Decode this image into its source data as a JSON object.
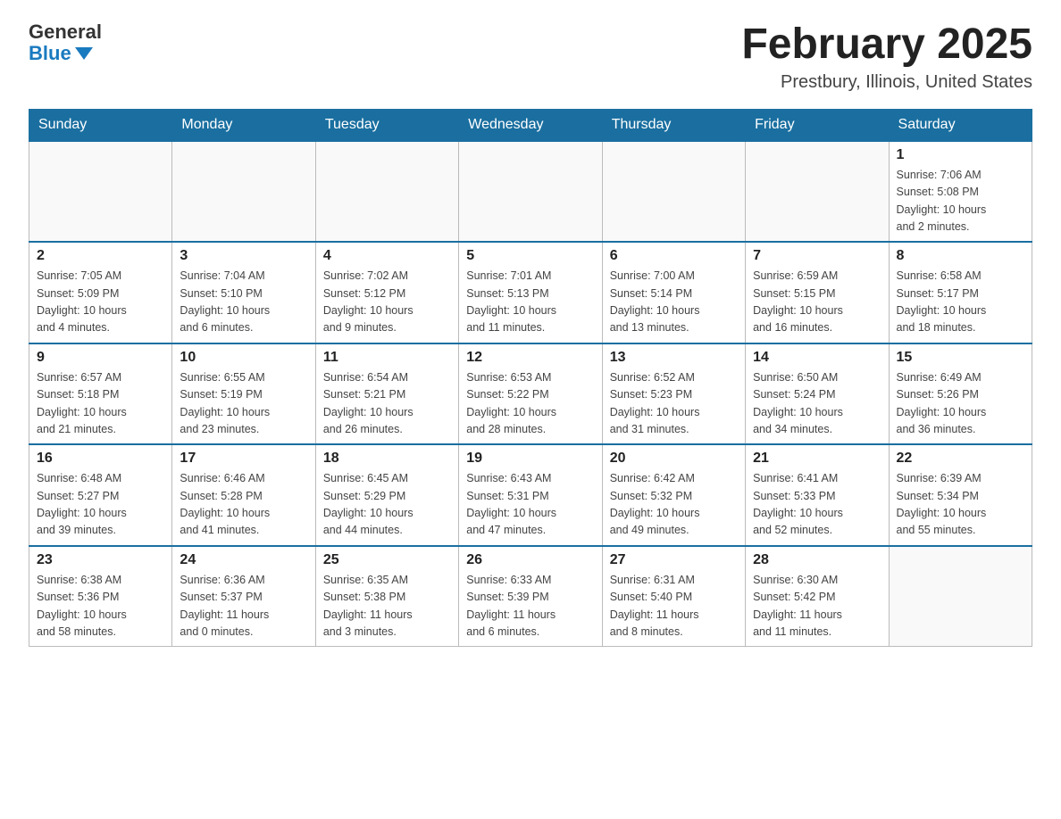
{
  "logo": {
    "general": "General",
    "blue": "Blue"
  },
  "title": "February 2025",
  "subtitle": "Prestbury, Illinois, United States",
  "days_of_week": [
    "Sunday",
    "Monday",
    "Tuesday",
    "Wednesday",
    "Thursday",
    "Friday",
    "Saturday"
  ],
  "weeks": [
    [
      {
        "day": "",
        "info": ""
      },
      {
        "day": "",
        "info": ""
      },
      {
        "day": "",
        "info": ""
      },
      {
        "day": "",
        "info": ""
      },
      {
        "day": "",
        "info": ""
      },
      {
        "day": "",
        "info": ""
      },
      {
        "day": "1",
        "info": "Sunrise: 7:06 AM\nSunset: 5:08 PM\nDaylight: 10 hours\nand 2 minutes."
      }
    ],
    [
      {
        "day": "2",
        "info": "Sunrise: 7:05 AM\nSunset: 5:09 PM\nDaylight: 10 hours\nand 4 minutes."
      },
      {
        "day": "3",
        "info": "Sunrise: 7:04 AM\nSunset: 5:10 PM\nDaylight: 10 hours\nand 6 minutes."
      },
      {
        "day": "4",
        "info": "Sunrise: 7:02 AM\nSunset: 5:12 PM\nDaylight: 10 hours\nand 9 minutes."
      },
      {
        "day": "5",
        "info": "Sunrise: 7:01 AM\nSunset: 5:13 PM\nDaylight: 10 hours\nand 11 minutes."
      },
      {
        "day": "6",
        "info": "Sunrise: 7:00 AM\nSunset: 5:14 PM\nDaylight: 10 hours\nand 13 minutes."
      },
      {
        "day": "7",
        "info": "Sunrise: 6:59 AM\nSunset: 5:15 PM\nDaylight: 10 hours\nand 16 minutes."
      },
      {
        "day": "8",
        "info": "Sunrise: 6:58 AM\nSunset: 5:17 PM\nDaylight: 10 hours\nand 18 minutes."
      }
    ],
    [
      {
        "day": "9",
        "info": "Sunrise: 6:57 AM\nSunset: 5:18 PM\nDaylight: 10 hours\nand 21 minutes."
      },
      {
        "day": "10",
        "info": "Sunrise: 6:55 AM\nSunset: 5:19 PM\nDaylight: 10 hours\nand 23 minutes."
      },
      {
        "day": "11",
        "info": "Sunrise: 6:54 AM\nSunset: 5:21 PM\nDaylight: 10 hours\nand 26 minutes."
      },
      {
        "day": "12",
        "info": "Sunrise: 6:53 AM\nSunset: 5:22 PM\nDaylight: 10 hours\nand 28 minutes."
      },
      {
        "day": "13",
        "info": "Sunrise: 6:52 AM\nSunset: 5:23 PM\nDaylight: 10 hours\nand 31 minutes."
      },
      {
        "day": "14",
        "info": "Sunrise: 6:50 AM\nSunset: 5:24 PM\nDaylight: 10 hours\nand 34 minutes."
      },
      {
        "day": "15",
        "info": "Sunrise: 6:49 AM\nSunset: 5:26 PM\nDaylight: 10 hours\nand 36 minutes."
      }
    ],
    [
      {
        "day": "16",
        "info": "Sunrise: 6:48 AM\nSunset: 5:27 PM\nDaylight: 10 hours\nand 39 minutes."
      },
      {
        "day": "17",
        "info": "Sunrise: 6:46 AM\nSunset: 5:28 PM\nDaylight: 10 hours\nand 41 minutes."
      },
      {
        "day": "18",
        "info": "Sunrise: 6:45 AM\nSunset: 5:29 PM\nDaylight: 10 hours\nand 44 minutes."
      },
      {
        "day": "19",
        "info": "Sunrise: 6:43 AM\nSunset: 5:31 PM\nDaylight: 10 hours\nand 47 minutes."
      },
      {
        "day": "20",
        "info": "Sunrise: 6:42 AM\nSunset: 5:32 PM\nDaylight: 10 hours\nand 49 minutes."
      },
      {
        "day": "21",
        "info": "Sunrise: 6:41 AM\nSunset: 5:33 PM\nDaylight: 10 hours\nand 52 minutes."
      },
      {
        "day": "22",
        "info": "Sunrise: 6:39 AM\nSunset: 5:34 PM\nDaylight: 10 hours\nand 55 minutes."
      }
    ],
    [
      {
        "day": "23",
        "info": "Sunrise: 6:38 AM\nSunset: 5:36 PM\nDaylight: 10 hours\nand 58 minutes."
      },
      {
        "day": "24",
        "info": "Sunrise: 6:36 AM\nSunset: 5:37 PM\nDaylight: 11 hours\nand 0 minutes."
      },
      {
        "day": "25",
        "info": "Sunrise: 6:35 AM\nSunset: 5:38 PM\nDaylight: 11 hours\nand 3 minutes."
      },
      {
        "day": "26",
        "info": "Sunrise: 6:33 AM\nSunset: 5:39 PM\nDaylight: 11 hours\nand 6 minutes."
      },
      {
        "day": "27",
        "info": "Sunrise: 6:31 AM\nSunset: 5:40 PM\nDaylight: 11 hours\nand 8 minutes."
      },
      {
        "day": "28",
        "info": "Sunrise: 6:30 AM\nSunset: 5:42 PM\nDaylight: 11 hours\nand 11 minutes."
      },
      {
        "day": "",
        "info": ""
      }
    ]
  ]
}
